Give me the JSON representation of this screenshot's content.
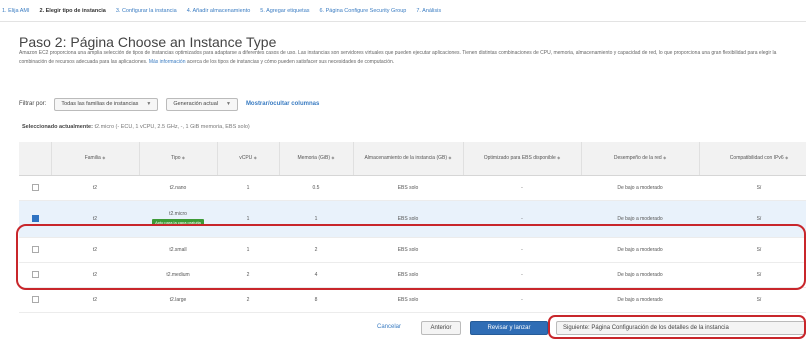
{
  "wizard_steps": [
    {
      "label": "1. Elija AMI",
      "active": false
    },
    {
      "label": "2. Elegir tipo de instancia",
      "active": true
    },
    {
      "label": "3. Configurar la instancia",
      "active": false
    },
    {
      "label": "4. Añadir almacenamiento",
      "active": false
    },
    {
      "label": "5. Agregar etiquetas",
      "active": false
    },
    {
      "label": "6. Página Configure Security Group",
      "active": false
    },
    {
      "label": "7. Análisis",
      "active": false
    }
  ],
  "page": {
    "title": "Paso 2: Página Choose an Instance Type",
    "description": "Amazon EC2 proporciona una amplia selección de tipos de instancias optimizados para adaptarse a diferentes casos de uso. Las instancias son servidores virtuales que pueden ejecutar aplicaciones. Tienen distintas combinaciones de CPU, memoria, almacenamiento y capacidad de red, lo que proporciona una gran flexibilidad para elegir la combinación de recursos adecuada para las aplicaciones.",
    "description_link": "Más información",
    "description_tail": "acerca de los tipos de instancias y cómo pueden satisfacer sus necesidades de computación."
  },
  "filters": {
    "label": "Filtrar por:",
    "family": "Todas las familias de instancias",
    "generation": "Generación actual",
    "columns_link": "Mostrar/ocultar columnas"
  },
  "selection": {
    "prefix": "Seleccionado actualmente:",
    "value": "t2.micro (- ECU, 1 vCPU, 2.5 GHz, -, 1 GiB memoria, EBS solo)"
  },
  "table": {
    "headers": [
      "Familia",
      "Tipo",
      "vCPU",
      "Memoria (GiB)",
      "Almacenamiento de la instancia (GB)",
      "Optimizado para EBS disponible",
      "Desempeño de la red",
      "Compatibilidad con IPv6"
    ],
    "free_tier_badge": "Apto para la capa gratuita",
    "rows": [
      {
        "family": "t2",
        "type": "t2.nano",
        "vcpu": "1",
        "memory": "0.5",
        "storage": "EBS solo",
        "ebs": "-",
        "network": "De bajo a moderado",
        "ipv6": "Sí",
        "selected": false
      },
      {
        "family": "t2",
        "type": "t2.micro",
        "vcpu": "1",
        "memory": "1",
        "storage": "EBS solo",
        "ebs": "-",
        "network": "De bajo a moderado",
        "ipv6": "Sí",
        "selected": true
      },
      {
        "family": "t2",
        "type": "t2.small",
        "vcpu": "1",
        "memory": "2",
        "storage": "EBS solo",
        "ebs": "-",
        "network": "De bajo a moderado",
        "ipv6": "Sí",
        "selected": false
      },
      {
        "family": "t2",
        "type": "t2.medium",
        "vcpu": "2",
        "memory": "4",
        "storage": "EBS solo",
        "ebs": "-",
        "network": "De bajo a moderado",
        "ipv6": "Sí",
        "selected": false
      },
      {
        "family": "t2",
        "type": "t2.large",
        "vcpu": "2",
        "memory": "8",
        "storage": "EBS solo",
        "ebs": "-",
        "network": "De bajo a moderado",
        "ipv6": "Sí",
        "selected": false
      }
    ]
  },
  "actions": {
    "cancel": "Cancelar",
    "previous": "Anterior",
    "review": "Revisar y lanzar",
    "next": "Siguiente: Página Configuración de los detalles de la instancia"
  },
  "colors": {
    "accent": "#2f6db5",
    "link": "#3a7cc2",
    "highlight": "#c8262b",
    "free_tier": "#3d9b37",
    "selected_row": "#e9f2fb"
  }
}
